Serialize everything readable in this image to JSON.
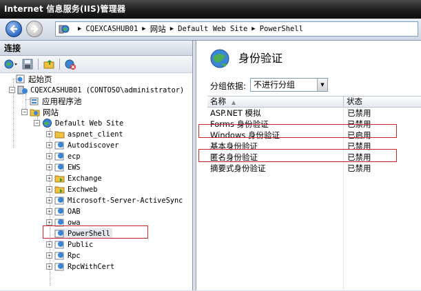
{
  "window": {
    "title": "Internet 信息服务(IIS)管理器"
  },
  "address": {
    "crumbs": [
      "CQEXCASHUB01",
      "网站",
      "Default Web Site",
      "PowerShell"
    ],
    "separator": "▶"
  },
  "left": {
    "header": "连接",
    "tree": {
      "start_page": "起始页",
      "server": "CQEXCASHUB01 (CONTOSO\\administrator)",
      "app_pools": "应用程序池",
      "sites": "网站",
      "default_site": "Default Web Site",
      "children": [
        "aspnet_client",
        "Autodiscover",
        "ecp",
        "EWS",
        "Exchange",
        "Exchweb",
        "Microsoft-Server-ActiveSync",
        "OAB",
        "owa",
        "PowerShell",
        "Public",
        "Rpc",
        "RpcWithCert"
      ],
      "selected": "PowerShell"
    }
  },
  "right": {
    "title": "身份验证",
    "group_label": "分组依据:",
    "group_value": "不进行分组",
    "columns": {
      "name": "名称",
      "status": "状态"
    },
    "rows": [
      {
        "name": "ASP.NET 模拟",
        "status": "已禁用"
      },
      {
        "name": "Forms 身份验证",
        "status": "已禁用"
      },
      {
        "name": "Windows 身份验证",
        "status": "已启用"
      },
      {
        "name": "基本身份验证",
        "status": "已禁用"
      },
      {
        "name": "匿名身份验证",
        "status": "已禁用"
      },
      {
        "name": "摘要式身份验证",
        "status": "已禁用"
      }
    ]
  },
  "colors": {
    "highlight": "#c8202a",
    "titlebar": "#1e1e1e"
  }
}
